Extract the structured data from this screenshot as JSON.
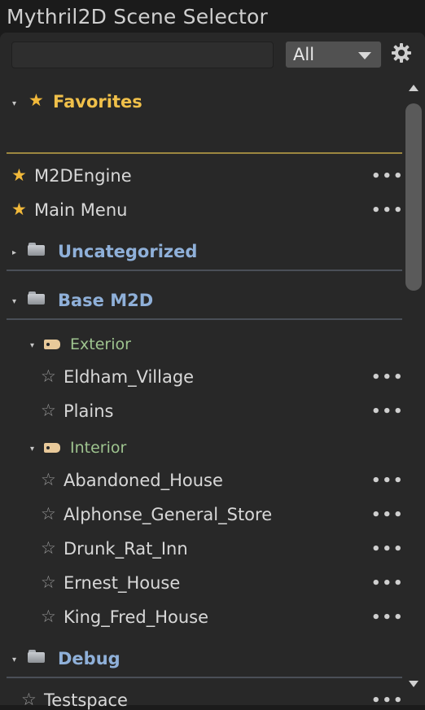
{
  "window": {
    "title": "Mythril2D Scene Selector"
  },
  "toolbar": {
    "search_value": "",
    "filter_selected": "All"
  },
  "sections": {
    "favorites": {
      "label": "Favorites",
      "items": [
        {
          "label": "M2DEngine",
          "more": "•••"
        },
        {
          "label": "Main Menu",
          "more": "•••"
        }
      ]
    },
    "uncategorized": {
      "label": "Uncategorized"
    },
    "base_m2d": {
      "label": "Base M2D",
      "exterior": {
        "label": "Exterior",
        "items": [
          {
            "label": "Eldham_Village",
            "more": "•••"
          },
          {
            "label": "Plains",
            "more": "•••"
          }
        ]
      },
      "interior": {
        "label": "Interior",
        "items": [
          {
            "label": "Abandoned_House",
            "more": "•••"
          },
          {
            "label": "Alphonse_General_Store",
            "more": "•••"
          },
          {
            "label": "Drunk_Rat_Inn",
            "more": "•••"
          },
          {
            "label": "Ernest_House",
            "more": "•••"
          },
          {
            "label": "King_Fred_House",
            "more": "•••"
          }
        ]
      }
    },
    "debug": {
      "label": "Debug",
      "items": [
        {
          "label": "Testspace",
          "more": "•••"
        }
      ]
    }
  },
  "glyphs": {
    "star_filled": "★",
    "star_empty": "☆",
    "caret_expanded": "▾",
    "caret_collapsed": "▸"
  },
  "colors": {
    "favorites": "#f0c04a",
    "category": "#8fb0d9",
    "subcategory": "#9ec48f"
  }
}
